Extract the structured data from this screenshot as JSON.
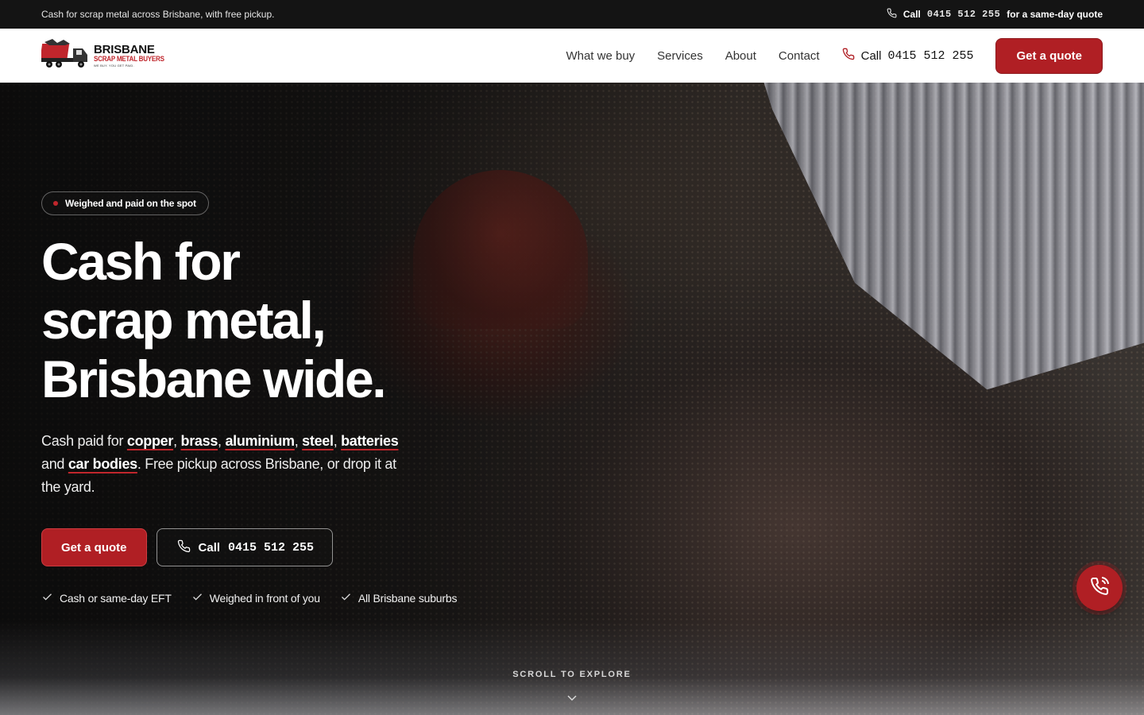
{
  "topbar": {
    "tagline": "Cash for scrap metal across Brisbane, with free pickup.",
    "call_label": "Call",
    "phone": "0415 512 255",
    "call_suffix": "for a same-day quote"
  },
  "brand": {
    "name_line1": "BRISBANE",
    "name_line2": "SCRAP METAL BUYERS",
    "slogan": "WE BUY. YOU GET PAID."
  },
  "nav": {
    "items": [
      "What we buy",
      "Services",
      "About",
      "Contact"
    ],
    "call_label": "Call",
    "phone": "0415 512 255",
    "quote_button": "Get a quote"
  },
  "hero": {
    "badge": "Weighed and paid on the spot",
    "title_line1": "Cash for",
    "title_line2": "scrap metal,",
    "title_line3": "Brisbane wide.",
    "lede": {
      "prefix": "Cash paid for",
      "materials": [
        "copper",
        "brass",
        "aluminium",
        "steel",
        "batteries"
      ],
      "and": "and",
      "last_material": "car bodies",
      "suffix": ". Free pickup across Brisbane, or drop it at the yard."
    },
    "cta_primary": "Get a quote",
    "cta_secondary_label": "Call",
    "cta_secondary_phone": "0415 512 255",
    "checks": [
      "Cash or same-day EFT",
      "Weighed in front of you",
      "All Brisbane suburbs"
    ],
    "scroll_hint": "SCROLL TO EXPLORE"
  },
  "colors": {
    "accent": "#b01f24",
    "topbar_bg": "#141414",
    "header_bg": "#ffffff"
  },
  "icons": {
    "phone": "phone-icon",
    "check": "check-icon",
    "chevron": "chevron-down-icon",
    "floating_call": "phone-call-icon"
  }
}
